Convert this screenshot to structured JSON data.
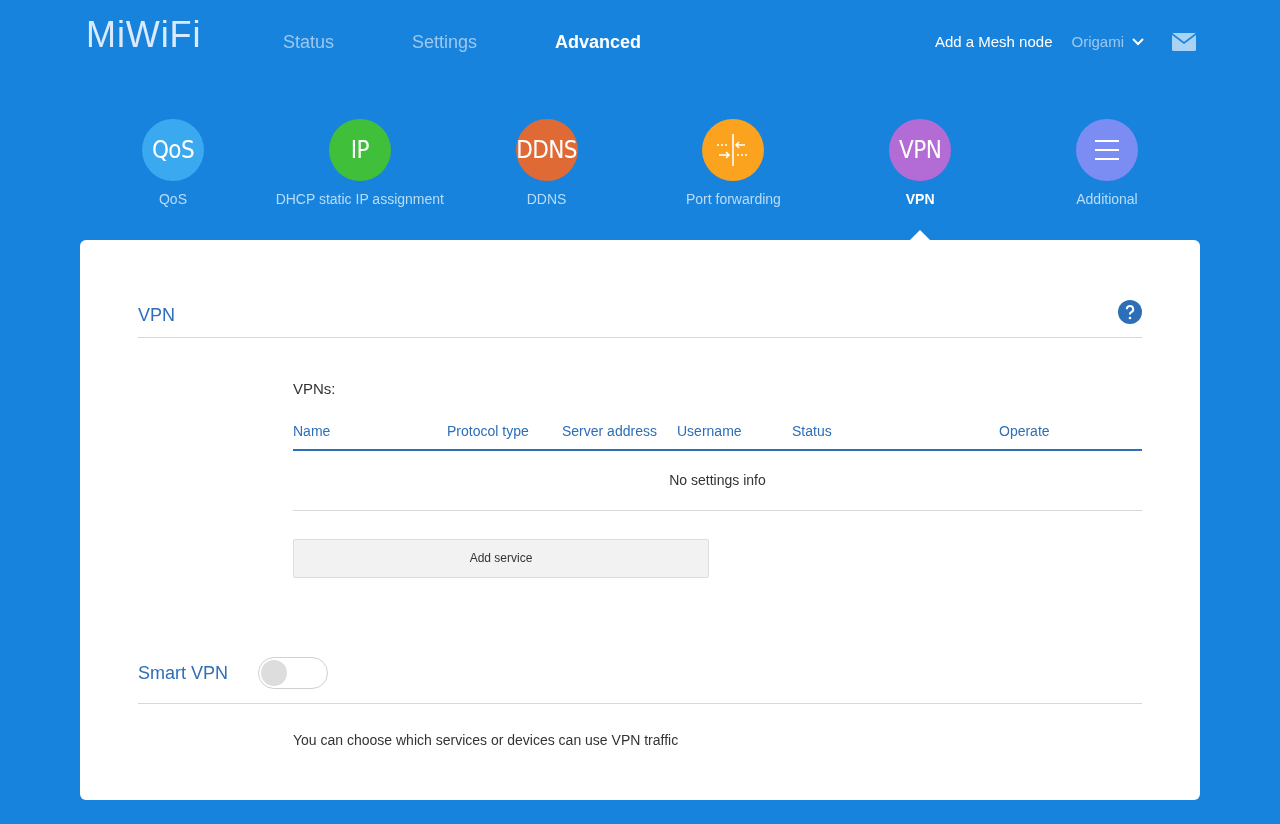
{
  "header": {
    "logo": "MiWiFi",
    "nav": [
      {
        "label": "Status",
        "selected": false
      },
      {
        "label": "Settings",
        "selected": false
      },
      {
        "label": "Advanced",
        "selected": true
      }
    ],
    "mesh_link": "Add a Mesh node",
    "user": "Origami"
  },
  "features": [
    {
      "kind": "text",
      "badge": "QoS",
      "label": "QoS",
      "color": "#3aa9f0",
      "selected": false
    },
    {
      "kind": "text",
      "badge": "IP",
      "label": "DHCP static IP assignment",
      "color": "#3fbf3a",
      "selected": false
    },
    {
      "kind": "text",
      "badge": "DDNS",
      "label": "DDNS",
      "color": "#e06a35",
      "selected": false
    },
    {
      "kind": "ports",
      "label": "Port forwarding",
      "color": "#fba21e",
      "selected": false
    },
    {
      "kind": "text",
      "badge": "VPN",
      "label": "VPN",
      "color": "#b36bd6",
      "selected": true
    },
    {
      "kind": "menu",
      "label": "Additional",
      "color": "#7b8cf2",
      "selected": false
    }
  ],
  "vpn": {
    "title": "VPN",
    "list_label": "VPNs:",
    "columns": [
      "Name",
      "Protocol type",
      "Server address",
      "Username",
      "Status",
      "Operate"
    ],
    "empty": "No settings info",
    "add_button": "Add service"
  },
  "smart_vpn": {
    "title": "Smart VPN",
    "on": false,
    "description": "You can choose which services or devices can use VPN traffic"
  }
}
